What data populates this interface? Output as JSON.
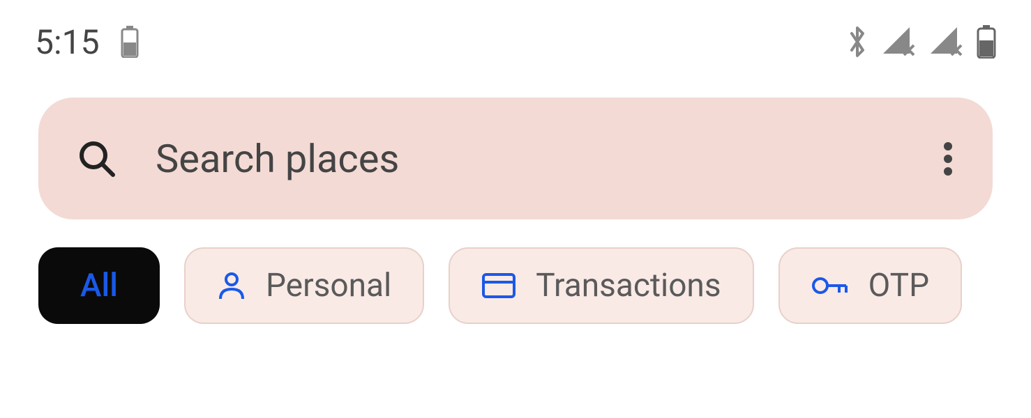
{
  "statusBar": {
    "time": "5:15",
    "icons": {
      "batteryLeft": "battery-half",
      "bluetooth": "bluetooth",
      "signal1": "signal-no-data",
      "signal2": "signal-no-data",
      "batteryRight": "battery-half"
    }
  },
  "searchBar": {
    "placeholder": "Search places",
    "icons": {
      "search": "search",
      "more": "more-vert"
    }
  },
  "chips": [
    {
      "label": "All",
      "active": true,
      "icon": null
    },
    {
      "label": "Personal",
      "active": false,
      "icon": "person"
    },
    {
      "label": "Transactions",
      "active": false,
      "icon": "card"
    },
    {
      "label": "OTP",
      "active": false,
      "icon": "key"
    }
  ],
  "colors": {
    "background": "#ffffff",
    "searchBarBg": "#f3dad4",
    "chipInactiveBg": "#f9eae6",
    "chipActiveBg": "#0a0a0a",
    "accentBlue": "#1a59e8",
    "textGray": "#5a5a5a"
  }
}
